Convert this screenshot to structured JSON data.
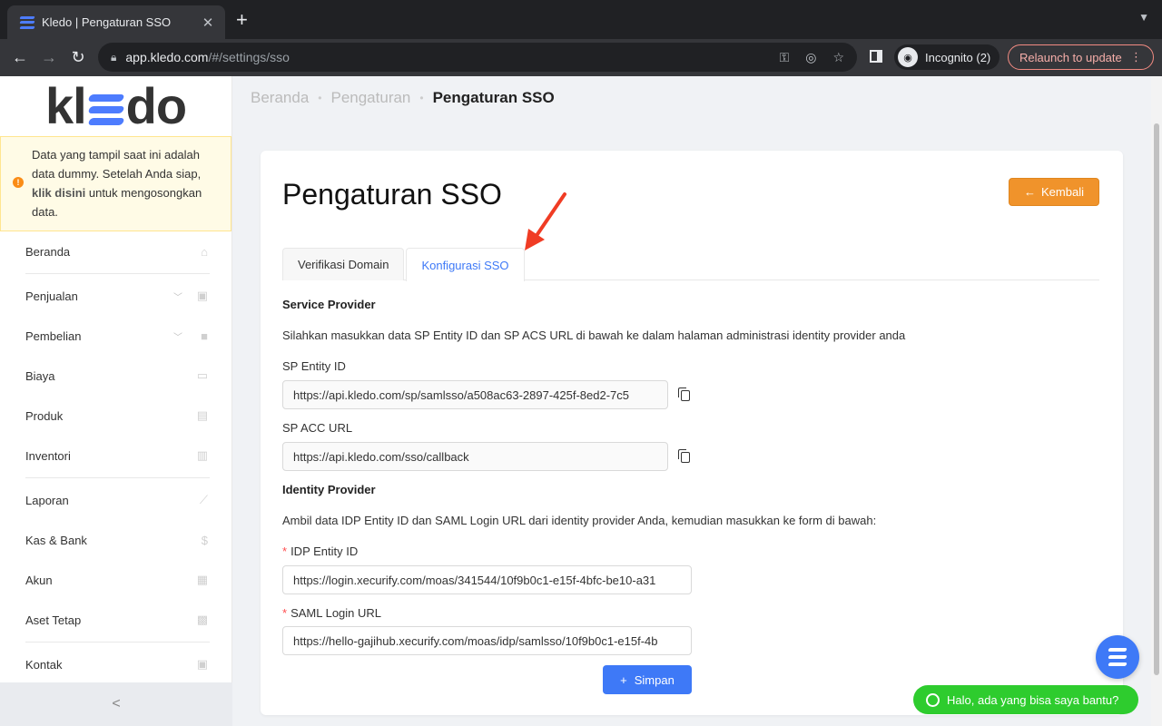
{
  "browser": {
    "tab_title": "Kledo | Pengaturan SSO",
    "url_host": "app.kledo.com",
    "url_path": "/#/settings/sso",
    "incognito_label": "Incognito (2)",
    "relaunch_label": "Relaunch to update"
  },
  "sidebar": {
    "brand_k": "kl",
    "brand_do": "do",
    "alert": {
      "text_before": "Data yang tampil saat ini adalah data dummy. Setelah Anda siap, ",
      "link": "klik disini",
      "text_after": " untuk mengosongkan data."
    },
    "items": [
      {
        "label": "Beranda",
        "icon": "home-icon"
      },
      {
        "label": "Penjualan",
        "icon": "basket-icon",
        "expandable": true
      },
      {
        "label": "Pembelian",
        "icon": "bag-icon",
        "expandable": true
      },
      {
        "label": "Biaya",
        "icon": "card-icon"
      },
      {
        "label": "Produk",
        "icon": "box-icon"
      },
      {
        "label": "Inventori",
        "icon": "warehouse-icon"
      },
      {
        "label": "Laporan",
        "icon": "chart-icon"
      },
      {
        "label": "Kas & Bank",
        "icon": "dollar-icon"
      },
      {
        "label": "Akun",
        "icon": "list-icon"
      },
      {
        "label": "Aset Tetap",
        "icon": "building-icon"
      },
      {
        "label": "Kontak",
        "icon": "contact-icon"
      }
    ],
    "collapse_label": "<"
  },
  "breadcrumb": {
    "home": "Beranda",
    "settings": "Pengaturan",
    "current": "Pengaturan SSO"
  },
  "page": {
    "title": "Pengaturan SSO",
    "back_label": "Kembali",
    "tabs": [
      "Verifikasi Domain",
      "Konfigurasi SSO"
    ],
    "active_tab": "Konfigurasi SSO"
  },
  "service_provider": {
    "heading": "Service Provider",
    "description": "Silahkan masukkan data SP Entity ID dan SP ACS URL di bawah ke dalam halaman administrasi identity provider anda",
    "entity_label": "SP Entity ID",
    "entity_value": "https://api.kledo.com/sp/samlsso/a508ac63-2897-425f-8ed2-7c5",
    "acc_label": "SP ACC URL",
    "acc_value": "https://api.kledo.com/sso/callback"
  },
  "identity_provider": {
    "heading": "Identity Provider",
    "description": "Ambil data IDP Entity ID dan SAML Login URL dari identity provider Anda, kemudian masukkan ke form di bawah:",
    "idp_label": "IDP Entity ID",
    "idp_value": "https://login.xecurify.com/moas/341544/10f9b0c1-e15f-4bfc-be10-a31",
    "saml_label": "SAML Login URL",
    "saml_value": "https://hello-gajihub.xecurify.com/moas/idp/samlsso/10f9b0c1-e15f-4b"
  },
  "actions": {
    "save_label": "Simpan"
  },
  "chat": {
    "whatsapp_label": "Halo, ada yang bisa saya bantu?"
  },
  "colors": {
    "primary": "#3e79f7",
    "warning_button": "#f0932b",
    "whatsapp": "#2ecc2e",
    "annotation_arrow": "#f03c24"
  }
}
